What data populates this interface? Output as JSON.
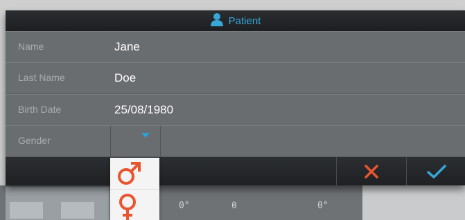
{
  "dialog": {
    "title": "Patient",
    "title_icon": "person-icon",
    "accent_color": "#36a7d6",
    "cancel_color": "#e8552e"
  },
  "fields": [
    {
      "label": "Name",
      "value": "Jane"
    },
    {
      "label": "Last Name",
      "value": "Doe"
    },
    {
      "label": "Birth Date",
      "value": "25/08/1980"
    },
    {
      "label": "Gender",
      "value": ""
    }
  ],
  "gender_options": [
    {
      "icon": "male-symbol-icon",
      "symbol": "♂"
    },
    {
      "icon": "female-symbol-icon",
      "symbol": "♀"
    }
  ],
  "buttons": {
    "cancel_icon": "close-icon",
    "confirm_icon": "check-icon"
  },
  "background_app": {
    "readouts": [
      "0°",
      "θ",
      "0°"
    ]
  }
}
